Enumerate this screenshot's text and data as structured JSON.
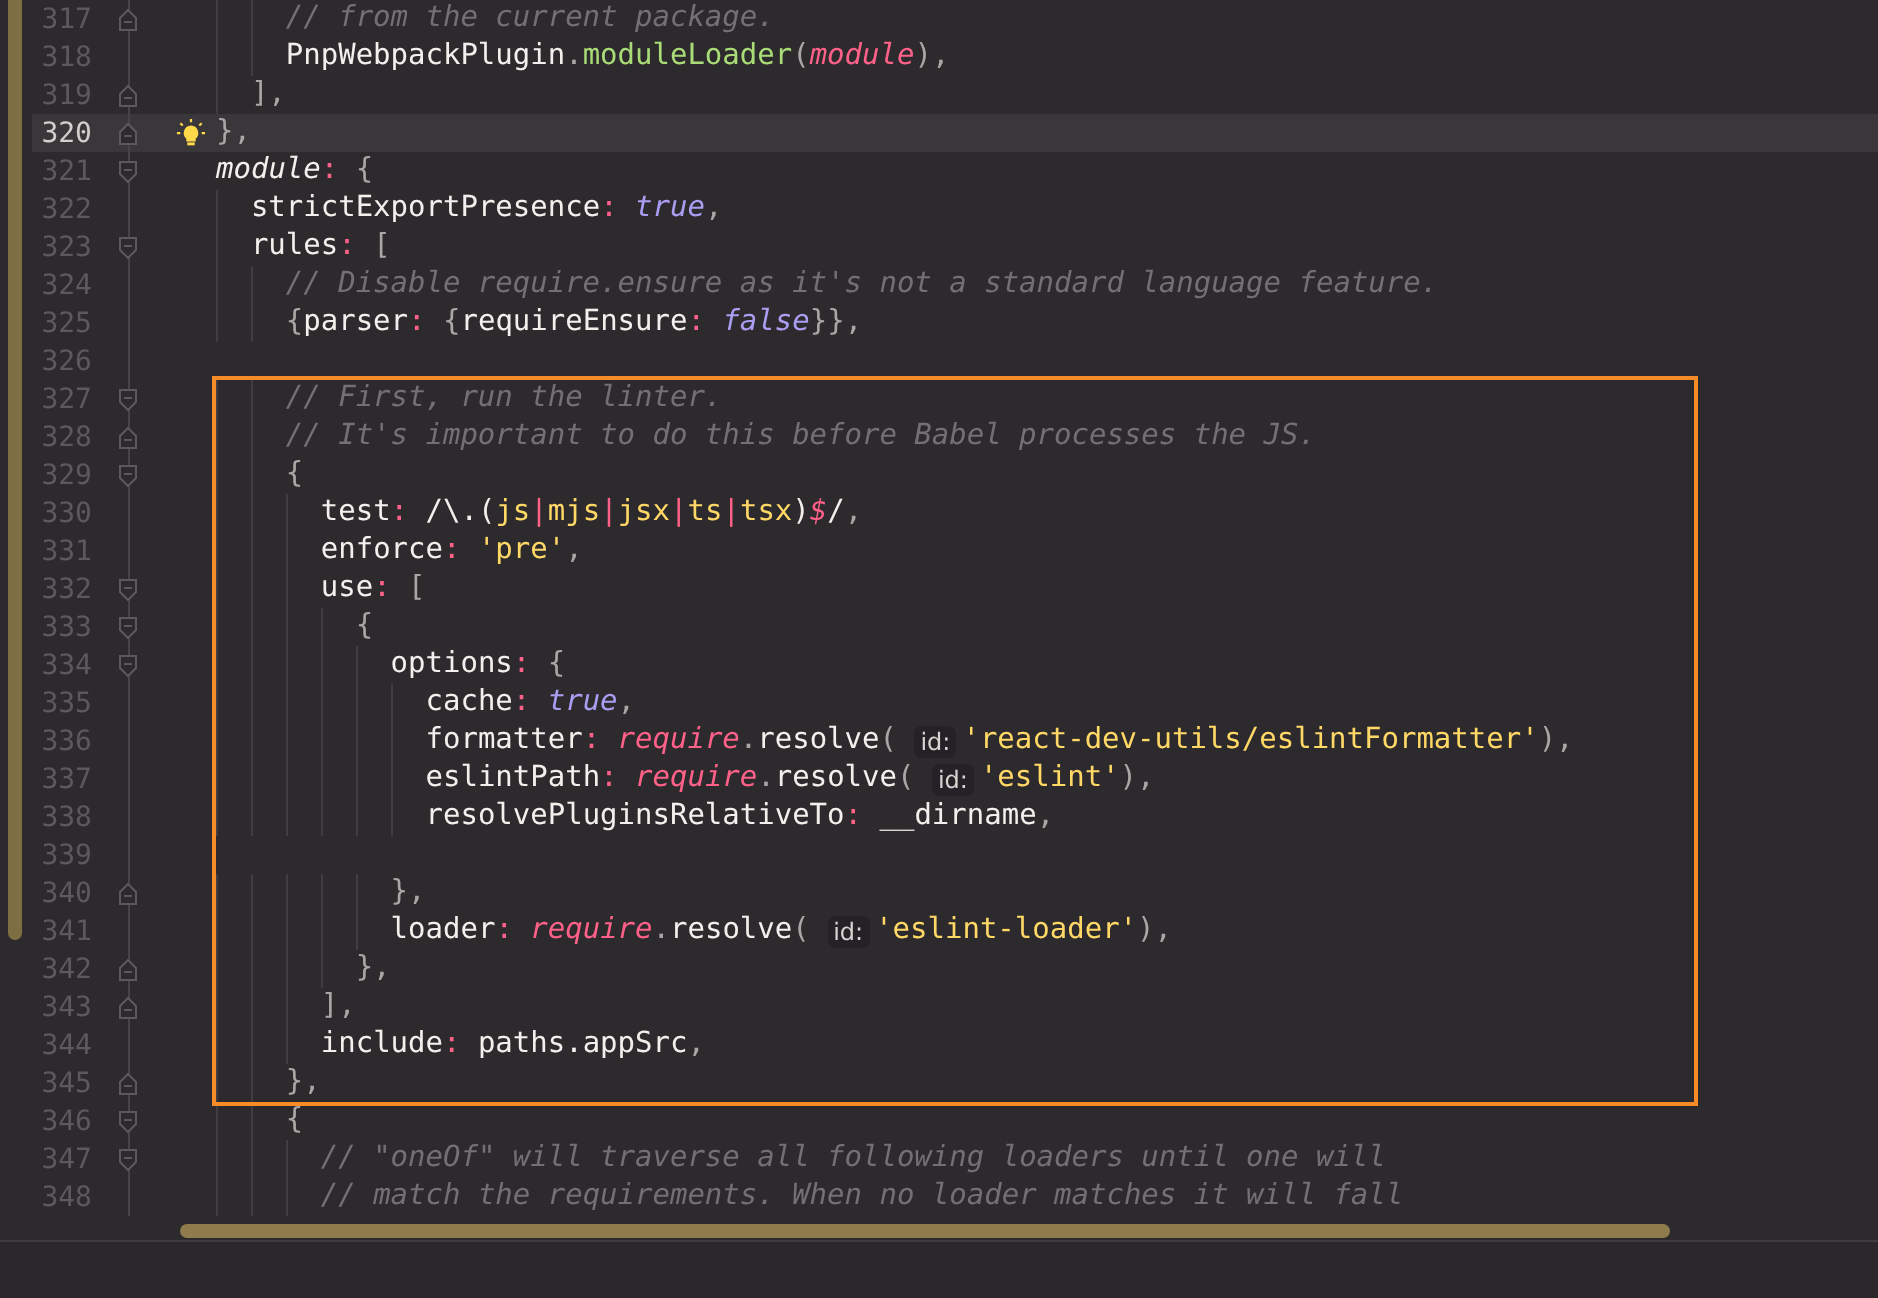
{
  "editor": {
    "lines": [
      {
        "number": "317",
        "fold_start": false,
        "fold_end": true,
        "current": false,
        "tokens": [
          {
            "kind": "comment",
            "text": "    // from the current package."
          }
        ]
      },
      {
        "number": "318",
        "fold_start": false,
        "fold_end": false,
        "current": false,
        "tokens": [
          {
            "kind": "plain",
            "text": "    PnpWebpackPlugin"
          },
          {
            "kind": "punct",
            "text": "."
          },
          {
            "kind": "method",
            "text": "moduleLoader"
          },
          {
            "kind": "punct",
            "text": "("
          },
          {
            "kind": "global",
            "text": "module"
          },
          {
            "kind": "punct",
            "text": "),"
          }
        ]
      },
      {
        "number": "319",
        "fold_start": false,
        "fold_end": true,
        "current": false,
        "tokens": [
          {
            "kind": "punct",
            "text": "  ],"
          }
        ]
      },
      {
        "number": "320",
        "fold_start": false,
        "fold_end": true,
        "current": true,
        "tokens": [
          {
            "kind": "punct",
            "text": "},"
          }
        ]
      },
      {
        "number": "321",
        "fold_start": true,
        "fold_end": false,
        "current": false,
        "tokens": [
          {
            "kind": "italic",
            "text": "module"
          },
          {
            "kind": "op",
            "text": ":"
          },
          {
            "kind": "punct",
            "text": " {"
          }
        ]
      },
      {
        "number": "322",
        "fold_start": false,
        "fold_end": false,
        "current": false,
        "tokens": [
          {
            "kind": "plain",
            "text": "  strictExportPresence"
          },
          {
            "kind": "op",
            "text": ":"
          },
          {
            "kind": "const",
            "text": " true"
          },
          {
            "kind": "punct",
            "text": ","
          }
        ]
      },
      {
        "number": "323",
        "fold_start": true,
        "fold_end": false,
        "current": false,
        "tokens": [
          {
            "kind": "plain",
            "text": "  rules"
          },
          {
            "kind": "op",
            "text": ":"
          },
          {
            "kind": "punct",
            "text": " ["
          }
        ]
      },
      {
        "number": "324",
        "fold_start": false,
        "fold_end": false,
        "current": false,
        "tokens": [
          {
            "kind": "comment",
            "text": "    // Disable require.ensure as it's not a standard language feature."
          }
        ]
      },
      {
        "number": "325",
        "fold_start": false,
        "fold_end": false,
        "current": false,
        "tokens": [
          {
            "kind": "punct",
            "text": "    {"
          },
          {
            "kind": "plain",
            "text": "parser"
          },
          {
            "kind": "op",
            "text": ":"
          },
          {
            "kind": "punct",
            "text": " {"
          },
          {
            "kind": "plain",
            "text": "requireEnsure"
          },
          {
            "kind": "op",
            "text": ":"
          },
          {
            "kind": "const",
            "text": " false"
          },
          {
            "kind": "punct",
            "text": "}},"
          }
        ]
      },
      {
        "number": "326",
        "fold_start": false,
        "fold_end": false,
        "current": false
      },
      {
        "number": "327",
        "fold_start": true,
        "fold_end": false,
        "current": false,
        "tokens": [
          {
            "kind": "comment",
            "text": "    // First, run the linter."
          }
        ]
      },
      {
        "number": "328",
        "fold_start": false,
        "fold_end": true,
        "current": false,
        "tokens": [
          {
            "kind": "comment",
            "text": "    // It's important to do this before Babel processes the JS."
          }
        ]
      },
      {
        "number": "329",
        "fold_start": true,
        "fold_end": false,
        "current": false,
        "tokens": [
          {
            "kind": "punct",
            "text": "    {"
          }
        ]
      },
      {
        "number": "330",
        "fold_start": false,
        "fold_end": false,
        "current": false,
        "tokens": [
          {
            "kind": "plain",
            "text": "      test"
          },
          {
            "kind": "op",
            "text": ":"
          },
          {
            "kind": "plain",
            "text": " /\\.("
          },
          {
            "kind": "string",
            "text": "js"
          },
          {
            "kind": "op",
            "text": "|"
          },
          {
            "kind": "string",
            "text": "mjs"
          },
          {
            "kind": "op",
            "text": "|"
          },
          {
            "kind": "string",
            "text": "jsx"
          },
          {
            "kind": "op",
            "text": "|"
          },
          {
            "kind": "string",
            "text": "ts"
          },
          {
            "kind": "op",
            "text": "|"
          },
          {
            "kind": "string",
            "text": "tsx"
          },
          {
            "kind": "plain",
            "text": ")"
          },
          {
            "kind": "global",
            "text": "$"
          },
          {
            "kind": "plain",
            "text": "/"
          },
          {
            "kind": "punct",
            "text": ","
          }
        ]
      },
      {
        "number": "331",
        "fold_start": false,
        "fold_end": false,
        "current": false,
        "tokens": [
          {
            "kind": "plain",
            "text": "      enforce"
          },
          {
            "kind": "op",
            "text": ":"
          },
          {
            "kind": "string",
            "text": " 'pre'"
          },
          {
            "kind": "punct",
            "text": ","
          }
        ]
      },
      {
        "number": "332",
        "fold_start": true,
        "fold_end": false,
        "current": false,
        "tokens": [
          {
            "kind": "plain",
            "text": "      use"
          },
          {
            "kind": "op",
            "text": ":"
          },
          {
            "kind": "punct",
            "text": " ["
          }
        ]
      },
      {
        "number": "333",
        "fold_start": true,
        "fold_end": false,
        "current": false,
        "tokens": [
          {
            "kind": "punct",
            "text": "        {"
          }
        ]
      },
      {
        "number": "334",
        "fold_start": true,
        "fold_end": false,
        "current": false,
        "tokens": [
          {
            "kind": "plain",
            "text": "          options"
          },
          {
            "kind": "op",
            "text": ":"
          },
          {
            "kind": "punct",
            "text": " {"
          }
        ]
      },
      {
        "number": "335",
        "fold_start": false,
        "fold_end": false,
        "current": false,
        "tokens": [
          {
            "kind": "plain",
            "text": "            cache"
          },
          {
            "kind": "op",
            "text": ":"
          },
          {
            "kind": "const",
            "text": " true"
          },
          {
            "kind": "punct",
            "text": ","
          }
        ]
      },
      {
        "number": "336",
        "fold_start": false,
        "fold_end": false,
        "current": false,
        "tokens": [
          {
            "kind": "plain",
            "text": "            formatter"
          },
          {
            "kind": "op",
            "text": ":"
          },
          {
            "kind": "global",
            "text": " require"
          },
          {
            "kind": "punct",
            "text": "."
          },
          {
            "kind": "plain",
            "text": "resolve"
          },
          {
            "kind": "punct",
            "text": "( "
          },
          {
            "kind": "hint",
            "text": "id:"
          },
          {
            "kind": "string",
            "text": "'react-dev-utils/eslintFormatter'"
          },
          {
            "kind": "punct",
            "text": "),"
          }
        ]
      },
      {
        "number": "337",
        "fold_start": false,
        "fold_end": false,
        "current": false,
        "tokens": [
          {
            "kind": "plain",
            "text": "            eslintPath"
          },
          {
            "kind": "op",
            "text": ":"
          },
          {
            "kind": "global",
            "text": " require"
          },
          {
            "kind": "punct",
            "text": "."
          },
          {
            "kind": "plain",
            "text": "resolve"
          },
          {
            "kind": "punct",
            "text": "( "
          },
          {
            "kind": "hint",
            "text": "id:"
          },
          {
            "kind": "string",
            "text": "'eslint'"
          },
          {
            "kind": "punct",
            "text": "),"
          }
        ]
      },
      {
        "number": "338",
        "fold_start": false,
        "fold_end": false,
        "current": false,
        "tokens": [
          {
            "kind": "plain",
            "text": "            resolvePluginsRelativeTo"
          },
          {
            "kind": "op",
            "text": ":"
          },
          {
            "kind": "plain",
            "text": " __dirname"
          },
          {
            "kind": "punct",
            "text": ","
          }
        ]
      },
      {
        "number": "339",
        "fold_start": false,
        "fold_end": false,
        "current": false
      },
      {
        "number": "340",
        "fold_start": false,
        "fold_end": true,
        "current": false,
        "tokens": [
          {
            "kind": "punct",
            "text": "          },"
          }
        ]
      },
      {
        "number": "341",
        "fold_start": false,
        "fold_end": false,
        "current": false,
        "tokens": [
          {
            "kind": "plain",
            "text": "          loader"
          },
          {
            "kind": "op",
            "text": ":"
          },
          {
            "kind": "global",
            "text": " require"
          },
          {
            "kind": "punct",
            "text": "."
          },
          {
            "kind": "plain",
            "text": "resolve"
          },
          {
            "kind": "punct",
            "text": "( "
          },
          {
            "kind": "hint",
            "text": "id:"
          },
          {
            "kind": "string",
            "text": "'eslint-loader'"
          },
          {
            "kind": "punct",
            "text": "),"
          }
        ]
      },
      {
        "number": "342",
        "fold_start": false,
        "fold_end": true,
        "current": false,
        "tokens": [
          {
            "kind": "punct",
            "text": "        },"
          }
        ]
      },
      {
        "number": "343",
        "fold_start": false,
        "fold_end": true,
        "current": false,
        "tokens": [
          {
            "kind": "punct",
            "text": "      ],"
          }
        ]
      },
      {
        "number": "344",
        "fold_start": false,
        "fold_end": false,
        "current": false,
        "tokens": [
          {
            "kind": "plain",
            "text": "      include"
          },
          {
            "kind": "op",
            "text": ":"
          },
          {
            "kind": "plain",
            "text": " paths.appSrc"
          },
          {
            "kind": "punct",
            "text": ","
          }
        ]
      },
      {
        "number": "345",
        "fold_start": false,
        "fold_end": true,
        "current": false,
        "tokens": [
          {
            "kind": "punct",
            "text": "    },"
          }
        ]
      },
      {
        "number": "346",
        "fold_start": true,
        "fold_end": false,
        "current": false,
        "tokens": [
          {
            "kind": "punct",
            "text": "    {"
          }
        ]
      },
      {
        "number": "347",
        "fold_start": true,
        "fold_end": false,
        "current": false,
        "tokens": [
          {
            "kind": "comment",
            "text": "      // \"oneOf\" will traverse all following loaders until one will"
          }
        ]
      },
      {
        "number": "348",
        "fold_start": false,
        "fold_end": false,
        "current": false,
        "tokens": [
          {
            "kind": "comment",
            "text": "      // match the requirements. When no loader matches it will fall"
          }
        ]
      }
    ]
  }
}
